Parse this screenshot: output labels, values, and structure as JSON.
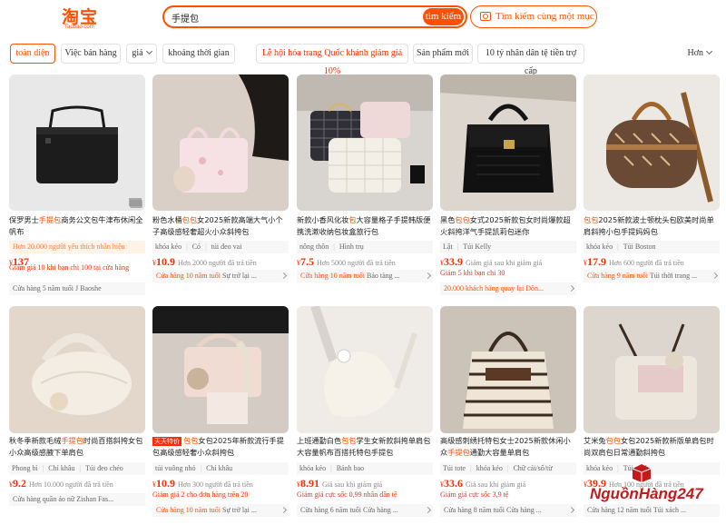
{
  "header": {
    "logo_text": "淘宝",
    "logo_sub": "Taobao.com",
    "search_value": "手提包",
    "search_button": "tìm kiếm",
    "same_button": "Tìm kiếm cùng một mục"
  },
  "filters": {
    "items": [
      "toàn diện",
      "Việc bán hàng",
      "giá",
      "khoảng thời gian",
      "Lễ hội hóa trang Quốc khánh giảm giá 10%",
      "Sản phẩm mới",
      "10 tỷ nhân dân tệ tiền trợ cấp"
    ],
    "more": "Hơn"
  },
  "products": [
    {
      "title_pre": "保罗男士",
      "title_hl": "手提包",
      "title_post": "商务公文包牛津布休闲全帆布",
      "notice": "Hơn 20.000 người yêu thích nhãn hiệu",
      "price": "137",
      "sold": "",
      "promo": "Giảm giá 10 khi bạn chi 100 tại cửa hàng",
      "shop": "Cửa hàng 5 năm tuổi J Baoshe",
      "shop_year": ""
    },
    {
      "title_pre": "粉色水桶",
      "title_hl": "包包",
      "title_post": "女2025新款高端大气小个子高级感轻奢超火小众斜挎包",
      "tags": [
        "khóa kéo",
        "Có",
        "túi đeo vai"
      ],
      "price": "10.9",
      "sold": "Hơn 2000 người đã trả tiền",
      "promo": "",
      "shop": "Sự trở lại ...",
      "shop_year": "Cửa hàng 10 năm tuổi"
    },
    {
      "title_pre": "新款小香风化妆",
      "title_hl": "包",
      "title_post": "大容量格子手提韩版便携洗漱收纳包妆盒旅行包",
      "tags": [
        "nông thôn",
        "Hình trụ"
      ],
      "price": "7.5",
      "sold": "Hơn 5000 người đã trả tiền",
      "promo": "",
      "shop": "Bảo tàng ...",
      "shop_year": "Cửa hàng 10 năm tuổi"
    },
    {
      "title_pre": "黑色",
      "title_hl": "包包",
      "title_post": "女式2025新款包女时尚爆款超火斜挎洋气手提凯莉包迷你",
      "tags": [
        "Lật",
        "Túi Kelly"
      ],
      "price": "33.9",
      "sold": "Giảm giá sau khi giảm giá",
      "promo": "Giảm 5 khi bạn chi 30",
      "notice2": "20.000 khách hàng quay lại Dôn...",
      "shop": "",
      "shop_year": ""
    },
    {
      "title_pre": "包包",
      "title_hl": "",
      "title_post": "2025新款波士顿枕头包欧美时尚单肩斜挎小包手提妈妈包",
      "tags": [
        "khóa kéo",
        "Túi Boston"
      ],
      "price": "17.9",
      "sold": "Hơn 600 người đã trả tiền",
      "promo": "",
      "shop": "Túi thời trang ...",
      "shop_year": "Cửa hàng 9 năm tuổi"
    },
    {
      "title_pre": "秋冬季新款毛绒",
      "title_hl": "手提包",
      "title_post": "时尚百搭斜挎女包小众高级感腋下单肩包",
      "tags": [
        "Phong bì",
        "Chỉ khâu",
        "Túi đeo chéo"
      ],
      "price": "9.2",
      "sold": "Hơn 10.000 người đã trả tiền",
      "promo": "",
      "shop": "Cửa hàng quần áo nữ Zishan Fas...",
      "shop_year": ""
    },
    {
      "title_pre": "包包",
      "title_hl": "",
      "title_post": "女包2025年新款流行手提包高级感轻奢小众斜挎包",
      "badge": "天天特价",
      "tags": [
        "túi vuông nhỏ",
        "Chỉ khâu"
      ],
      "price": "10.9",
      "sold": "Hơn 300 người đã trả tiền",
      "promo": "Giảm giá 2 cho đơn hàng trên 20",
      "shop": "Sự trở lại ...",
      "shop_year": "Cửa hàng 10 năm tuổi"
    },
    {
      "title_pre": "上班通勤白色",
      "title_hl": "包包",
      "title_post": "学生女新款斜挎单肩包大容量帆布百搭托特包手提包",
      "tags": [
        "khóa kéo",
        "Bánh bao"
      ],
      "price": "8.91",
      "sold": "Giá sau khi giảm giá",
      "promo": "Giảm giá cực sốc 0,99 nhân dân tệ",
      "shop": "Cửa hàng 6 năm tuổi Cửa hàng ...",
      "shop_year": ""
    },
    {
      "title_pre": "高级感刺绣托特包女士2025新款休闲小众",
      "title_hl": "手提包",
      "title_post": "通勤大容量单肩包",
      "tags": [
        "Túi tote",
        "khóa kéo",
        "Chữ cái/số/từ"
      ],
      "price": "33.6",
      "sold": "Giá sau khi giảm giá",
      "promo": "Giảm giá cực sốc 3,9 tệ",
      "shop": "Cửa hàng 8 năm tuổi Cửa hàng ...",
      "shop_year": ""
    },
    {
      "title_pre": "艾米兔",
      "title_hl": "包包",
      "title_post": "女包2025新款新版单肩包时尚双肩包日常通勤斜挎包",
      "tags": [
        "khóa kéo",
        "Túi xách"
      ],
      "price": "39.9",
      "sold": "Hơn 100 người đã trả tiền",
      "promo": "",
      "shop": "Cửa hàng 12 năm tuổi Túi xách ...",
      "shop_year": ""
    }
  ],
  "watermark": "NguồnHàng247"
}
